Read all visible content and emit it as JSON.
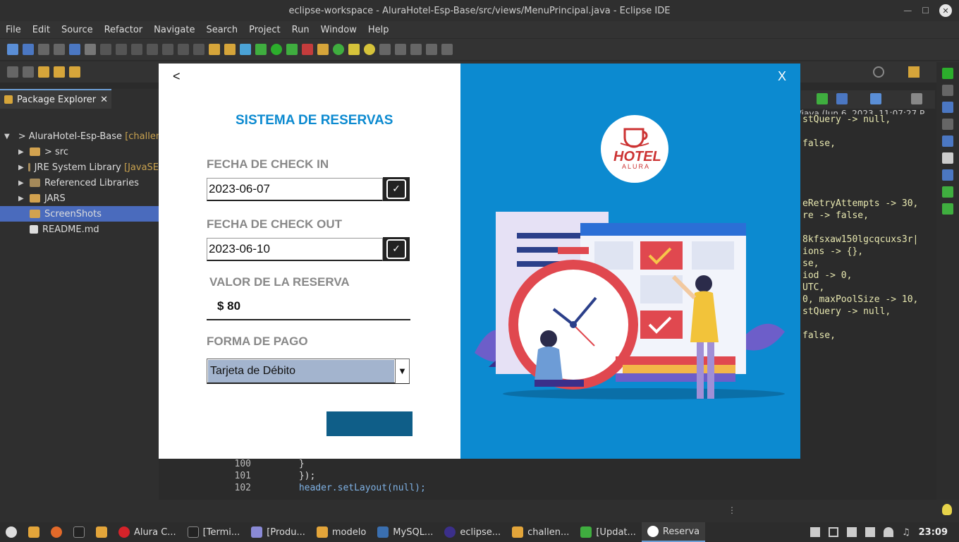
{
  "window": {
    "title": "eclipse-workspace - AluraHotel-Esp-Base/src/views/MenuPrincipal.java - Eclipse IDE"
  },
  "menu": [
    "File",
    "Edit",
    "Source",
    "Refactor",
    "Navigate",
    "Search",
    "Project",
    "Run",
    "Window",
    "Help"
  ],
  "package_explorer": {
    "tab_label": "Package Explorer",
    "close": "✕",
    "items": [
      {
        "label": "> AluraHotel-Esp-Base",
        "suffix": "[challen"
      },
      {
        "label": "> src"
      },
      {
        "label": "JRE System Library",
        "suffix": "[JavaSE"
      },
      {
        "label": "Referenced Libraries"
      },
      {
        "label": "JARS"
      },
      {
        "label": "ScreenShots"
      },
      {
        "label": "README.md"
      }
    ]
  },
  "editor_right": {
    "header": "n/java  (Jun 6, 2023, 11:07:27 P",
    "lines": [
      "stQuery -> null,",
      "",
      "false,",
      "",
      "",
      "",
      "",
      "eRetryAttempts -> 30,",
      "re -> false,",
      "",
      "8kfsxaw150lgcqcuxs3r|",
      "ions -> {},",
      "se,",
      "iod -> 0,",
      "UTC,",
      "0, maxPoolSize -> 10,",
      "stQuery -> null,",
      "",
      "false,"
    ]
  },
  "code": {
    "lines": [
      {
        "num": "100",
        "text": "            }"
      },
      {
        "num": "101",
        "text": "        });"
      },
      {
        "num": "102",
        "text": "        header.setLayout(null);"
      }
    ]
  },
  "dialog": {
    "back": "<",
    "close": "X",
    "title": "SISTEMA DE RESERVAS",
    "checkin_label": "FECHA DE CHECK IN",
    "checkin_value": "2023-06-07",
    "checkout_label": "FECHA DE CHECK OUT",
    "checkout_value": "2023-06-10",
    "value_label": "VALOR DE LA RESERVA",
    "value": "$ 80",
    "payment_label": "FORMA DE PAGO",
    "payment_value": "Tarjeta de Débito",
    "logo_top": "HOTEL",
    "logo_bottom": "ALURA"
  },
  "taskbar": {
    "items": [
      "Alura C...",
      "[Termi...",
      "[Produ...",
      "modelo",
      "MySQL...",
      "eclipse...",
      "challen...",
      "[Updat...",
      "Reserva"
    ],
    "clock": "23:09"
  }
}
